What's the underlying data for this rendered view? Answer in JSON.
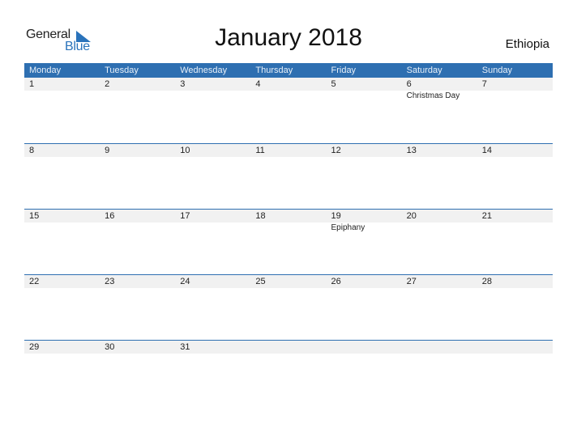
{
  "logo": {
    "word1": "General",
    "word2": "Blue",
    "icon": "triangle-flag-icon",
    "brand_color": "#2a73bb"
  },
  "title": "January 2018",
  "country": "Ethiopia",
  "header_color": "#2e6fb1",
  "weekdays": [
    "Monday",
    "Tuesday",
    "Wednesday",
    "Thursday",
    "Friday",
    "Saturday",
    "Sunday"
  ],
  "weeks": [
    {
      "days": [
        "1",
        "2",
        "3",
        "4",
        "5",
        "6",
        "7"
      ],
      "events": [
        "",
        "",
        "",
        "",
        "",
        "Christmas Day",
        ""
      ]
    },
    {
      "days": [
        "8",
        "9",
        "10",
        "11",
        "12",
        "13",
        "14"
      ],
      "events": [
        "",
        "",
        "",
        "",
        "",
        "",
        ""
      ]
    },
    {
      "days": [
        "15",
        "16",
        "17",
        "18",
        "19",
        "20",
        "21"
      ],
      "events": [
        "",
        "",
        "",
        "",
        "Epiphany",
        "",
        ""
      ]
    },
    {
      "days": [
        "22",
        "23",
        "24",
        "25",
        "26",
        "27",
        "28"
      ],
      "events": [
        "",
        "",
        "",
        "",
        "",
        "",
        ""
      ]
    },
    {
      "days": [
        "29",
        "30",
        "31",
        "",
        "",
        "",
        ""
      ],
      "events": [
        "",
        "",
        "",
        "",
        "",
        "",
        ""
      ]
    }
  ]
}
